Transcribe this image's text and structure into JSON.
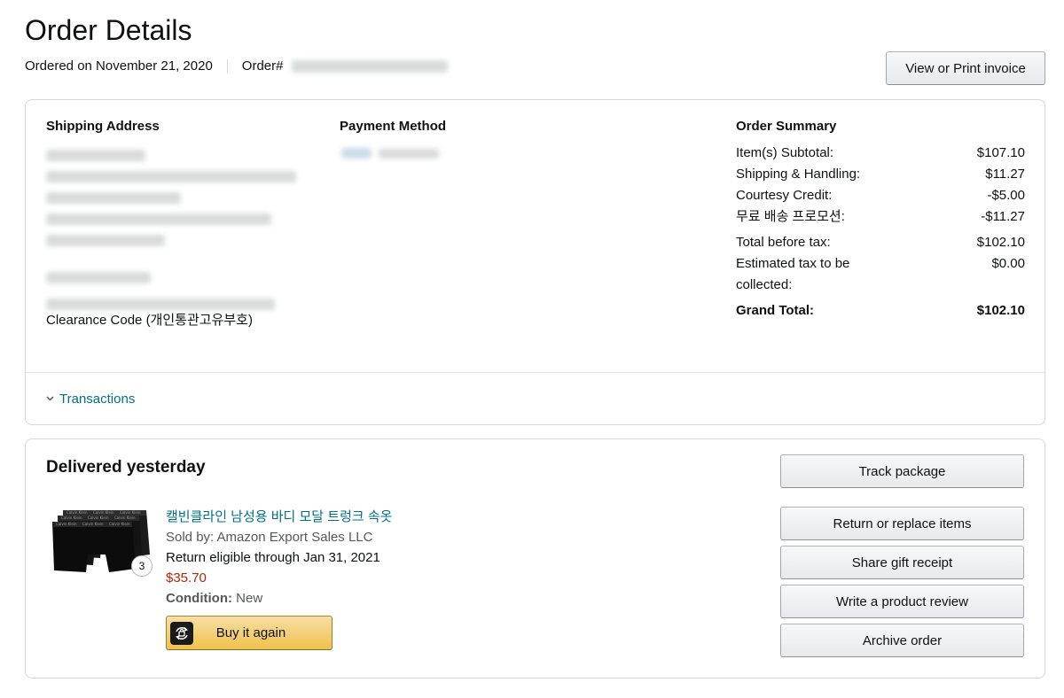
{
  "header": {
    "title": "Order Details",
    "ordered_on": "Ordered on November 21, 2020",
    "order_label": "Order#",
    "print_invoice": "View or Print invoice"
  },
  "shipping": {
    "heading": "Shipping Address",
    "clearance": "Clearance Code (개인통관고유부호)"
  },
  "payment": {
    "heading": "Payment Method"
  },
  "summary": {
    "heading": "Order Summary",
    "rows": [
      {
        "label": "Item(s) Subtotal:",
        "value": "$107.10"
      },
      {
        "label": "Shipping & Handling:",
        "value": "$11.27"
      },
      {
        "label": "Courtesy Credit:",
        "value": "-$5.00"
      },
      {
        "label": "무료 배송 프로모션:",
        "value": "-$11.27"
      },
      {
        "label": "Total before tax:",
        "value": "$102.10"
      },
      {
        "label": "Estimated tax to be collected:",
        "value": "$0.00"
      },
      {
        "label": "Grand Total:",
        "value": "$102.10"
      }
    ]
  },
  "transactions": {
    "label": "Transactions"
  },
  "shipment": {
    "status": "Delivered yesterday",
    "item": {
      "title": "캘빈클라인 남성용 바디 모달 트렁크 속옷",
      "sold_by": "Sold by: Amazon Export Sales LLC",
      "return_eligible": "Return eligible through Jan 31, 2021",
      "price": "$35.70",
      "condition_label": "Condition:",
      "condition_value": "New",
      "quantity": "3",
      "buy_again": "Buy it again"
    },
    "actions": {
      "track": "Track package",
      "return": "Return or replace items",
      "gift": "Share gift receipt",
      "review": "Write a product review",
      "archive": "Archive order"
    }
  },
  "colors": {
    "link": "#007185",
    "price": "#b12704",
    "buy_again_button": "#f0c14b",
    "border": "#d5d9d9"
  }
}
